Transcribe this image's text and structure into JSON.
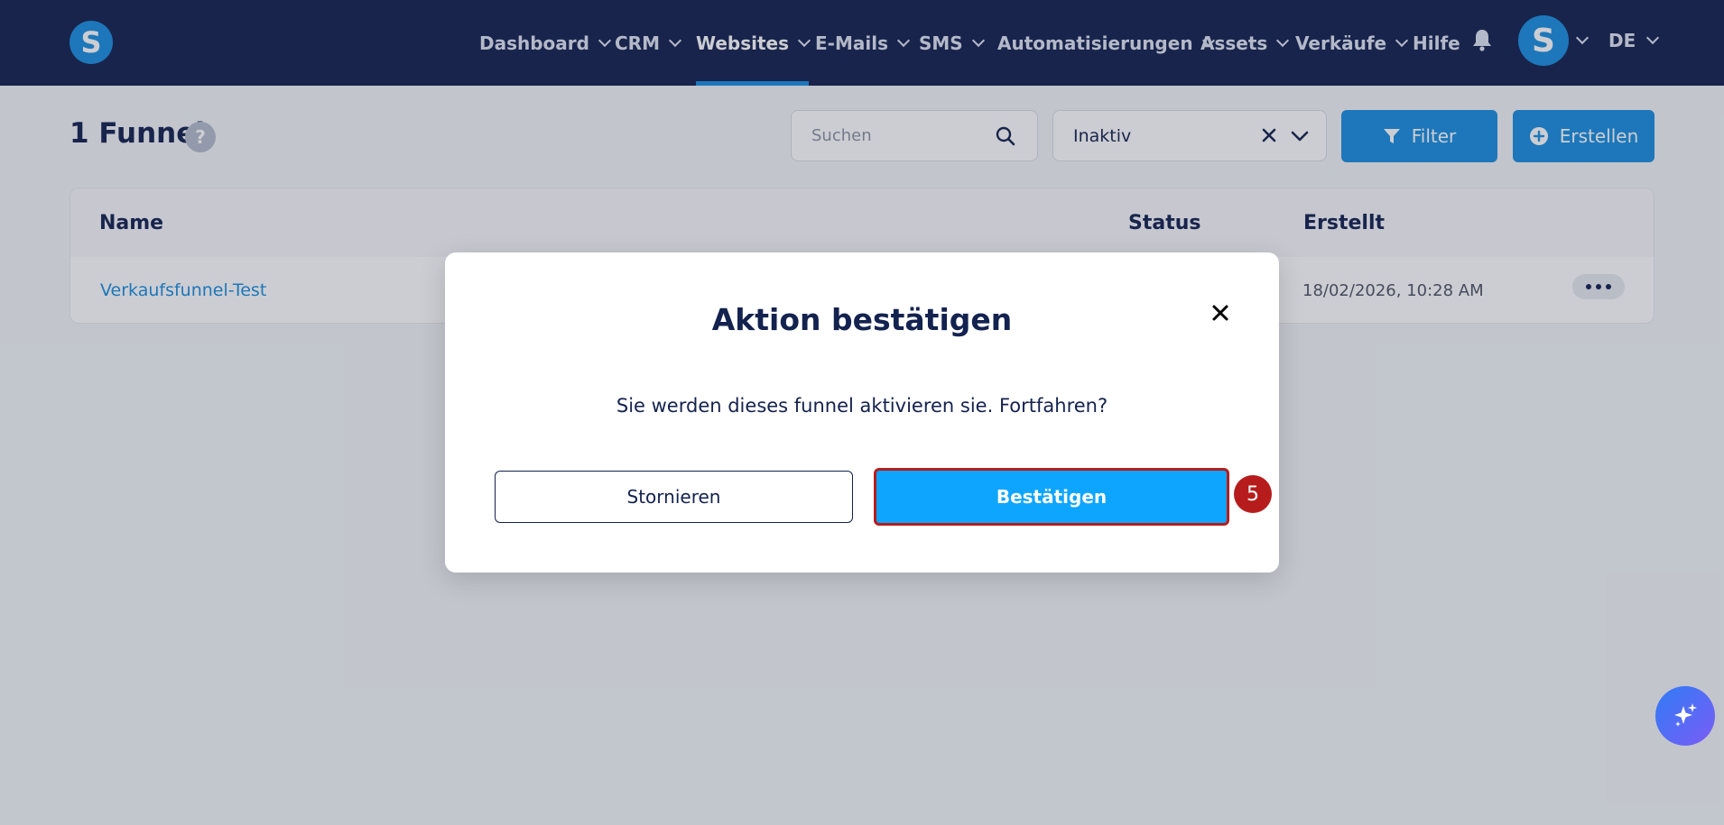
{
  "nav": {
    "items": [
      {
        "label": "Dashboard"
      },
      {
        "label": "CRM"
      },
      {
        "label": "Websites"
      },
      {
        "label": "E-Mails"
      },
      {
        "label": "SMS"
      },
      {
        "label": "Automatisierungen"
      },
      {
        "label": "Assets"
      },
      {
        "label": "Verkäufe"
      },
      {
        "label": "Hilfe"
      }
    ],
    "active_item": "Websites",
    "logo_letter": "S",
    "avatar_letter": "S",
    "language": "DE"
  },
  "header": {
    "title": "1 Funnel",
    "help_glyph": "?"
  },
  "toolbar": {
    "search_placeholder": "Suchen",
    "status_filter_value": "Inaktiv",
    "filter_label": "Filter",
    "create_label": "Erstellen"
  },
  "table": {
    "columns": [
      "Name",
      "Status",
      "Erstellt"
    ],
    "rows": [
      {
        "name": "Verkaufsfunnel-Test",
        "created": "18/02/2026, 10:28 AM"
      }
    ]
  },
  "modal": {
    "title": "Aktion bestätigen",
    "message": "Sie werden dieses funnel aktivieren sie. Fortfahren?",
    "cancel_label": "Stornieren",
    "confirm_label": "Bestätigen",
    "step_number": "5"
  },
  "icons": {
    "bell": "bell-icon",
    "search": "search-icon",
    "clear": "close-icon",
    "dropdown": "chevron-down-icon",
    "filter": "filter-icon",
    "create": "plus-circle-icon",
    "more": "more-horizontal-icon",
    "ai": "sparkles-icon"
  },
  "colors": {
    "nav_bg": "#13224f",
    "accent": "#1a8fe0",
    "confirm_bg": "#0ea5ff",
    "highlight_border": "#b71c1c"
  }
}
